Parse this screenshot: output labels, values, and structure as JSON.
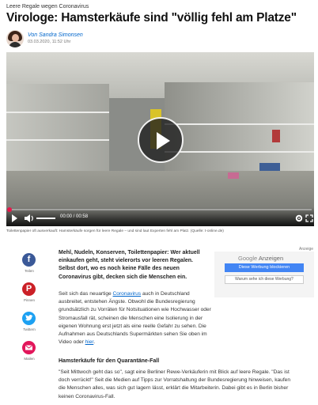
{
  "article": {
    "kicker": "Leere Regale wegen Coronavirus",
    "headline": "Virologe: Hamsterkäufe sind \"völlig fehl am Platze\"",
    "author": "Von Sandra Simonsen",
    "date": "03.03.2020, 11:52 Uhr"
  },
  "video": {
    "time": "00:00 / 00:58",
    "caption": "Toilettenpapier oft ausverkauft: Hamsterkäufe sorgen für leere Regale – und sind laut Experten fehl am Platz. (Quelle: t-online.de)"
  },
  "share": [
    {
      "label": "Teilen",
      "icon": "facebook-icon",
      "color": "#3b5998"
    },
    {
      "label": "Pinnen",
      "icon": "pinterest-icon",
      "color": "#cb2027"
    },
    {
      "label": "Twittern",
      "icon": "twitter-icon",
      "color": "#1da1f2"
    },
    {
      "label": "Mailen",
      "icon": "mail-icon",
      "color": "#e2175b"
    }
  ],
  "body": {
    "lead": "Mehl, Nudeln, Konserven, Toilettenpapier: Wer aktuell einkaufen geht, steht vielerorts vor leeren Regalen. Selbst dort, wo es noch keine Fälle des neuen Coronavirus gibt, decken sich die Menschen ein.",
    "p1_start": "Seit sich das neuartige ",
    "p1_link": "Coronavirus",
    "p1_rest": " auch in Deutschland ausbreitet, entstehen Ängste. Obwohl die Bundesregierung grundsätzlich zu Vorräten für Notsituationen wie Hochwasser oder Stromausfall rät, scheinen die Menschen eine Isolierung in der eigenen Wohnung erst jetzt als eine reelle Gefahr zu sehen. Die Aufnahmen aus Deutschlands Supermärkten sehen Sie oben im Video oder ",
    "p1_link2": "hier",
    "p1_end": ".",
    "subhead": "Hamsterkäufe für den Quarantäne-Fall",
    "p2": "\"Seit Mittwoch geht das so\", sagt eine Berliner Rewe-Verkäuferin mit Blick auf leere Regale. \"Das ist doch verrückt!\" Seit die Medien auf Tipps zur Vorratshaltung der Bundesregierung hinweisen, kaufen die Menschen alles, was sich gut lagern lässt, erklärt die Mitarbeiterin. Dabei gibt es in Berlin bisher keinen Coronavirus-Fall."
  },
  "ad": {
    "label": "Anzeige",
    "title_google": "Google",
    "title_rest": " Anzeigen",
    "block_label": "Diese Werbung blockieren",
    "why_label": "Warum sehe ich diese Werbung?"
  },
  "colors": {
    "link": "#0066cc",
    "progress_dot": "#e8174a",
    "ad_button": "#4285f4"
  }
}
